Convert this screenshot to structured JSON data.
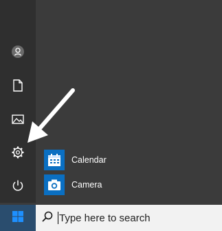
{
  "start_menu": {
    "rail": {
      "items": [
        {
          "icon": "user-avatar-icon"
        },
        {
          "icon": "documents-icon"
        },
        {
          "icon": "pictures-icon"
        },
        {
          "icon": "settings-gear-icon"
        },
        {
          "icon": "power-icon"
        }
      ]
    },
    "apps": [
      {
        "label": "Calendar",
        "icon": "calendar-icon"
      },
      {
        "label": "Camera",
        "icon": "camera-icon"
      }
    ]
  },
  "taskbar": {
    "start_icon": "windows-logo-icon",
    "search": {
      "icon": "search-icon",
      "placeholder": "Type here to search"
    }
  },
  "colors": {
    "rail_bg": "#2f2f2f",
    "menu_bg": "#3b3b3b",
    "accent": "#0a6fc2",
    "taskbar_bg": "#101010",
    "start_button_bg": "#2a4d6e",
    "search_bg": "#f2f2f2"
  }
}
